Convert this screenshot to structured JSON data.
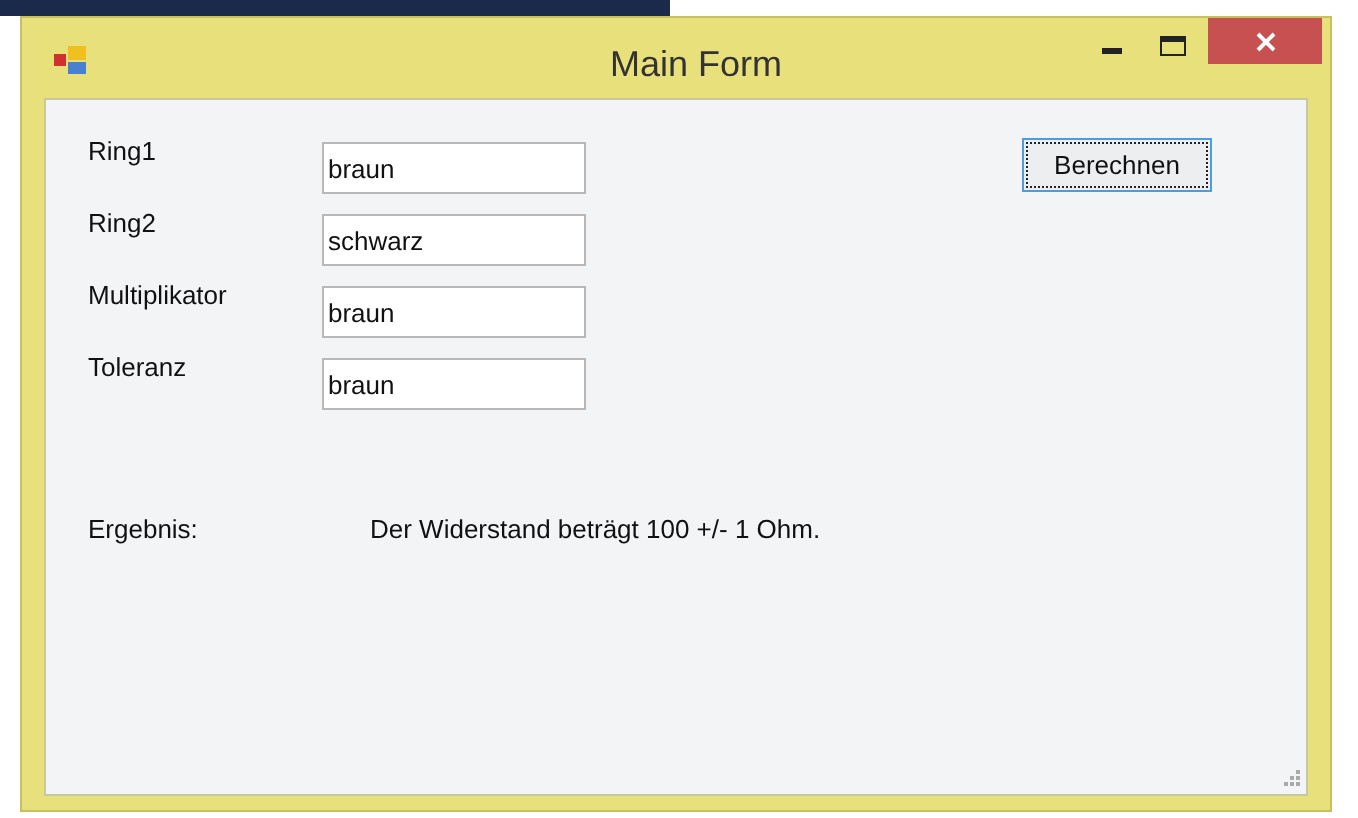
{
  "window": {
    "title": "Main Form"
  },
  "fields": [
    {
      "label": "Ring1",
      "value": "braun"
    },
    {
      "label": "Ring2",
      "value": "schwarz"
    },
    {
      "label": "Multiplikator",
      "value": "braun"
    },
    {
      "label": "Toleranz",
      "value": "braun"
    }
  ],
  "calculate_button": {
    "label": "Berechnen",
    "focused": true
  },
  "result": {
    "label": "Ergebnis:",
    "text": "Der Widerstand beträgt 100 +/- 1 Ohm."
  }
}
